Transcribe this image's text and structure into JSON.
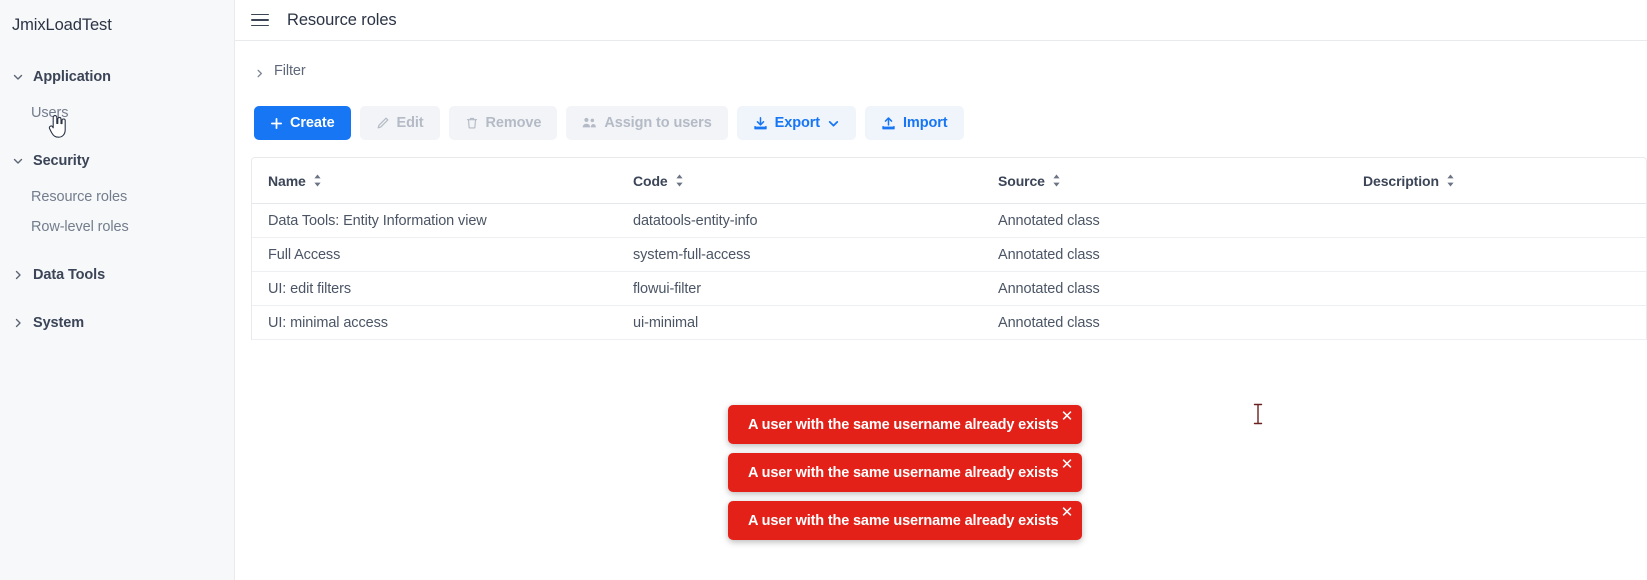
{
  "sidebar": {
    "brand": "JmixLoadTest",
    "groups": [
      {
        "label": "Application",
        "expanded": true,
        "icon": "chevron-down-icon",
        "items": [
          {
            "label": "Users"
          }
        ]
      },
      {
        "label": "Security",
        "expanded": true,
        "icon": "chevron-down-icon",
        "items": [
          {
            "label": "Resource roles"
          },
          {
            "label": "Row-level roles"
          }
        ]
      },
      {
        "label": "Data Tools",
        "expanded": false,
        "icon": "chevron-right-icon",
        "items": []
      },
      {
        "label": "System",
        "expanded": false,
        "icon": "chevron-right-icon",
        "items": []
      }
    ]
  },
  "topbar": {
    "menu_icon": "hamburger-icon",
    "title": "Resource roles"
  },
  "filter": {
    "label": "Filter",
    "icon": "chevron-right-icon",
    "expanded": false
  },
  "toolbar": {
    "create_label": "Create",
    "create_icon": "plus-icon",
    "edit_label": "Edit",
    "edit_icon": "pencil-icon",
    "remove_label": "Remove",
    "remove_icon": "trash-icon",
    "assign_label": "Assign to users",
    "assign_icon": "users-icon",
    "export_label": "Export",
    "export_icon": "download-icon",
    "export_caret_icon": "chevron-down-icon",
    "import_label": "Import",
    "import_icon": "upload-icon"
  },
  "grid": {
    "columns": [
      {
        "label": "Name",
        "sort_icon": "sort-icon"
      },
      {
        "label": "Code",
        "sort_icon": "sort-icon"
      },
      {
        "label": "Source",
        "sort_icon": "sort-icon"
      },
      {
        "label": "Description",
        "sort_icon": "sort-icon"
      }
    ],
    "rows": [
      {
        "name": "Data Tools: Entity Information view",
        "code": "datatools-entity-info",
        "source": "Annotated class",
        "description": ""
      },
      {
        "name": "Full Access",
        "code": "system-full-access",
        "source": "Annotated class",
        "description": ""
      },
      {
        "name": "UI: edit filters",
        "code": "flowui-filter",
        "source": "Annotated class",
        "description": ""
      },
      {
        "name": "UI: minimal access",
        "code": "ui-minimal",
        "source": "Annotated class",
        "description": ""
      }
    ]
  },
  "notifications": [
    {
      "message": "A user with the same username already exists",
      "close_icon": "close-icon"
    },
    {
      "message": "A user with the same username already exists",
      "close_icon": "close-icon"
    },
    {
      "message": "A user with the same username already exists",
      "close_icon": "close-icon"
    }
  ],
  "colors": {
    "primary": "#1676f3",
    "danger": "#e32119",
    "sidebar_bg": "#f7f8fa",
    "text": "#2b3445",
    "muted": "#737d8c"
  }
}
